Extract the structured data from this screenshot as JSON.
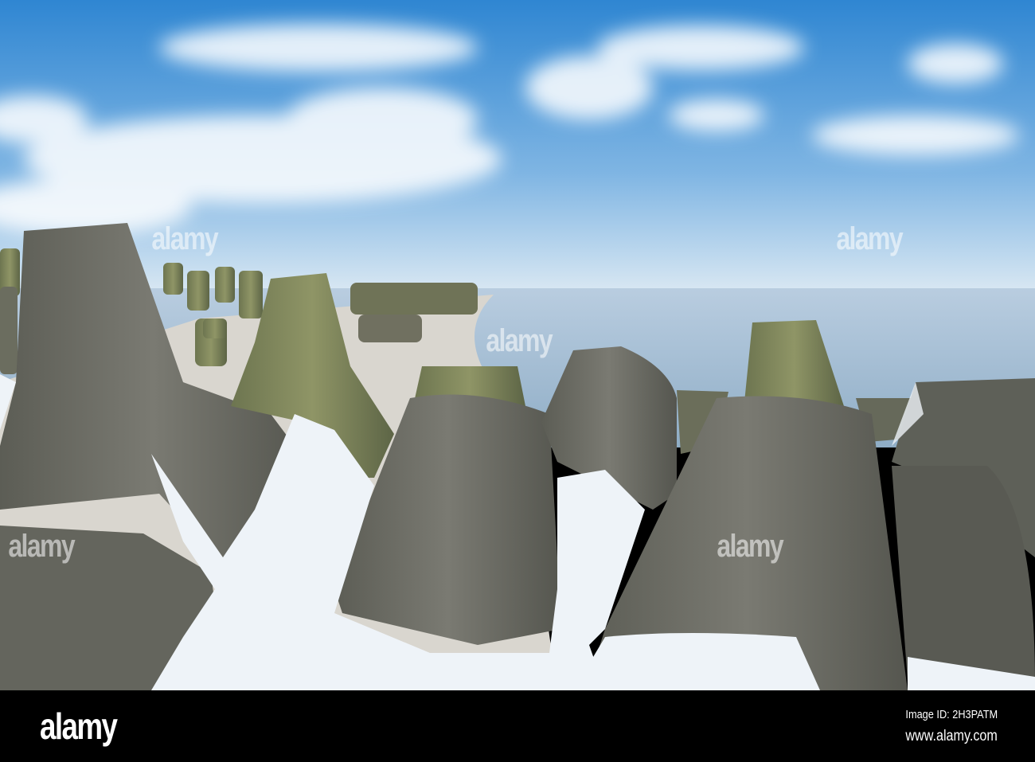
{
  "watermark": {
    "text": "alamy"
  },
  "footer": {
    "logo": "alamy",
    "image_id": "Image ID: 2H3PATM",
    "url": "www.alamy.com"
  },
  "colors": {
    "sky_top": "#2f8ad6",
    "sky_bottom": "#cfe2f2",
    "sea": "#a9c1d6",
    "concrete": "#6d6d66",
    "snow": "#eef3f8"
  }
}
